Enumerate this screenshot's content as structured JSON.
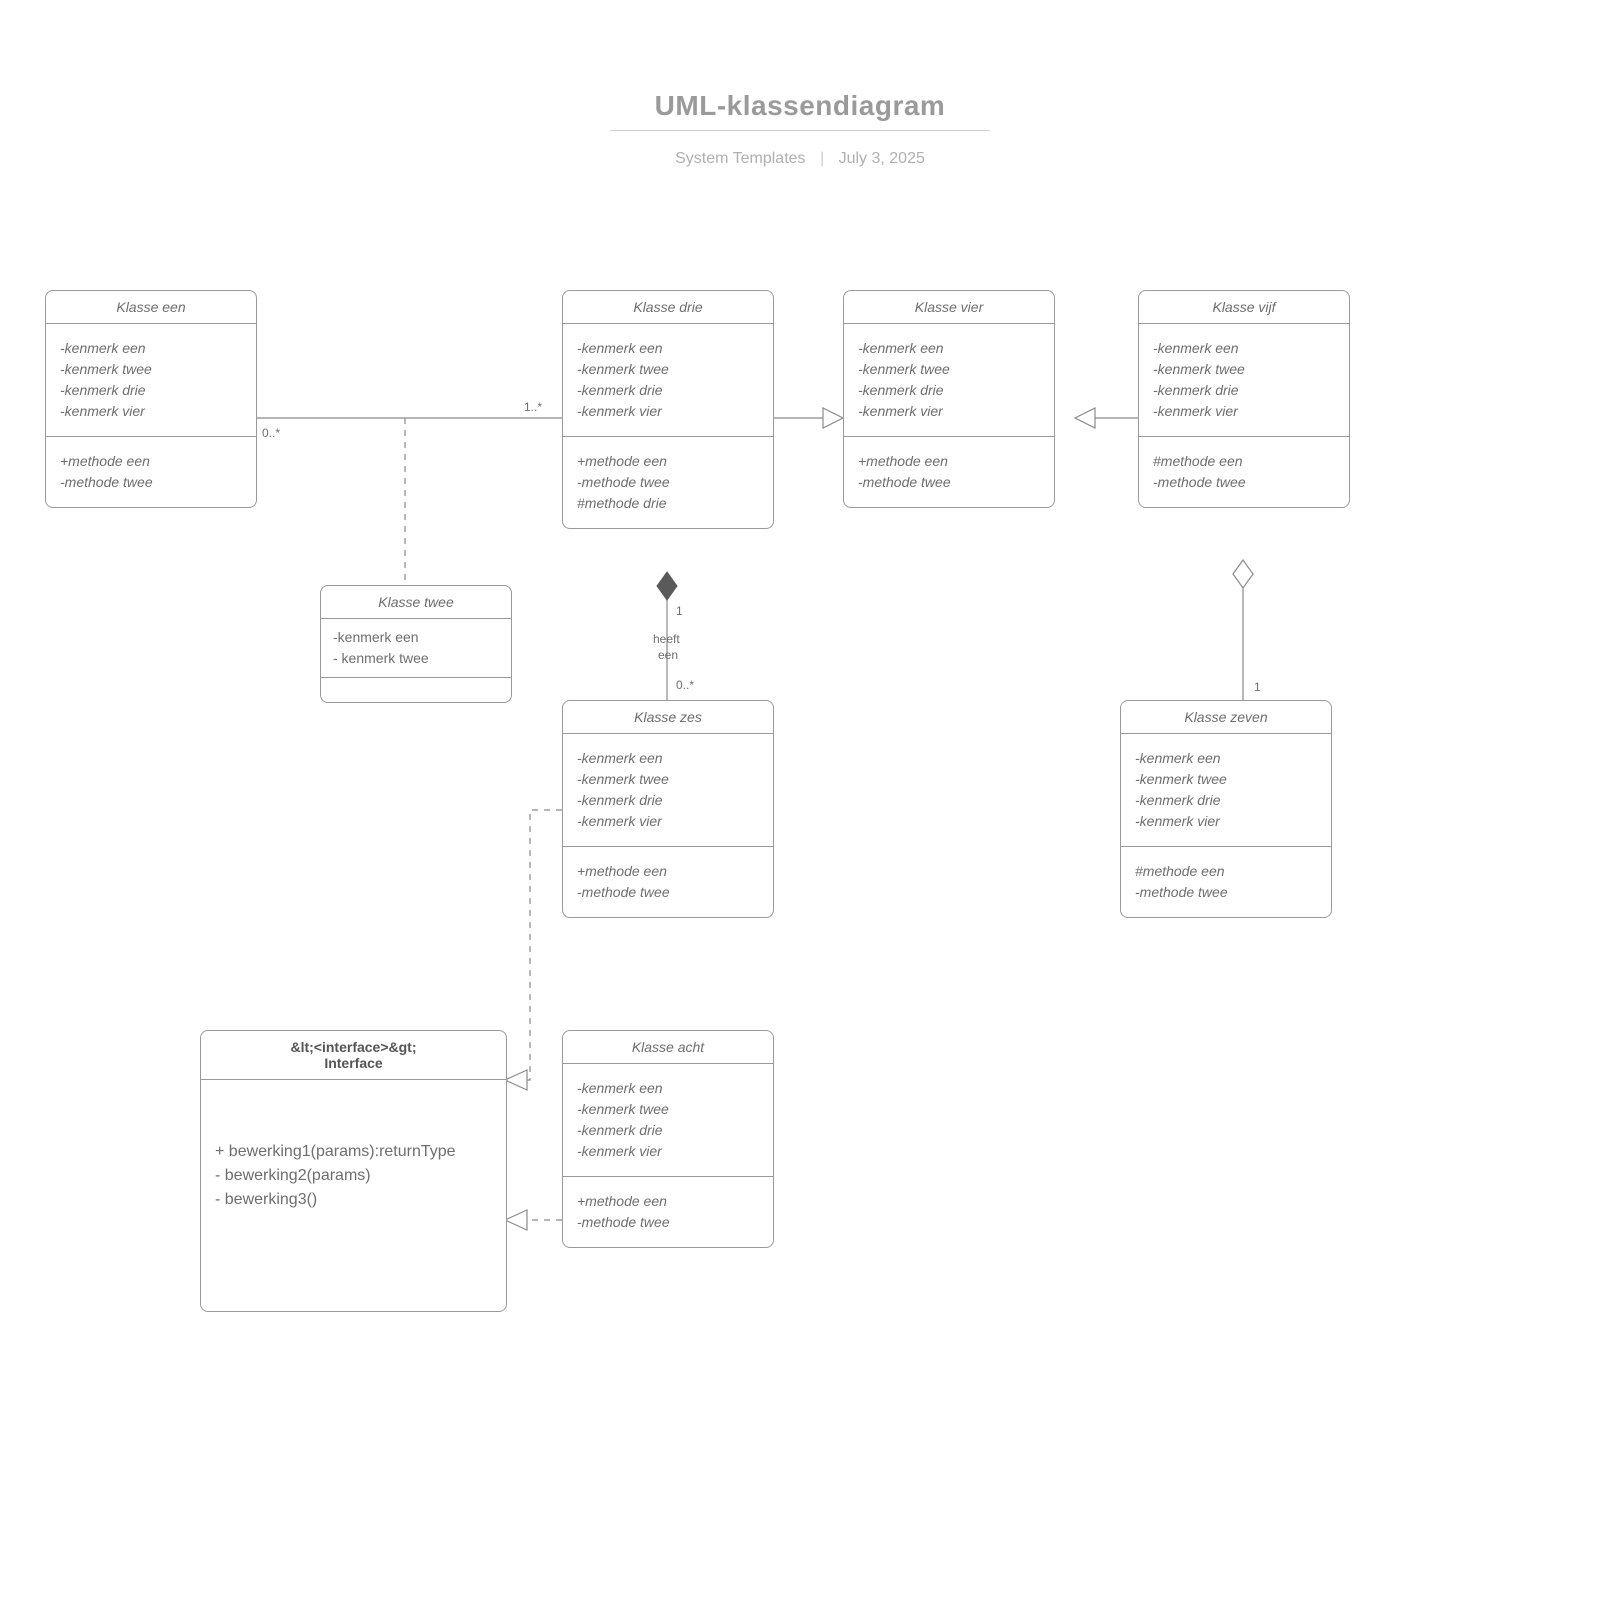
{
  "header": {
    "title": "UML-klassendiagram",
    "author": "System Templates",
    "date": "July 3, 2025"
  },
  "classes": {
    "k1": {
      "name": "Klasse een",
      "attrs": [
        "-kenmerk een",
        "-kenmerk twee",
        "-kenmerk drie",
        "-kenmerk vier"
      ],
      "ops": [
        "+methode een",
        "-methode twee"
      ]
    },
    "k2": {
      "name": "Klasse twee",
      "attrs": [
        "-kenmerk een",
        "- kenmerk twee"
      ],
      "ops": []
    },
    "k3": {
      "name": "Klasse drie",
      "attrs": [
        "-kenmerk een",
        "-kenmerk twee",
        "-kenmerk drie",
        "-kenmerk vier"
      ],
      "ops": [
        "+methode een",
        "-methode twee",
        "#methode drie"
      ]
    },
    "k4": {
      "name": "Klasse vier",
      "attrs": [
        "-kenmerk een",
        "-kenmerk twee",
        "-kenmerk drie",
        "-kenmerk vier"
      ],
      "ops": [
        "+methode een",
        "-methode twee"
      ]
    },
    "k5": {
      "name": "Klasse vijf",
      "attrs": [
        "-kenmerk een",
        "-kenmerk twee",
        "-kenmerk drie",
        "-kenmerk vier"
      ],
      "ops": [
        "#methode een",
        "-methode twee"
      ]
    },
    "k6": {
      "name": "Klasse zes",
      "attrs": [
        "-kenmerk een",
        "-kenmerk twee",
        "-kenmerk drie",
        "-kenmerk vier"
      ],
      "ops": [
        "+methode een",
        "-methode twee"
      ]
    },
    "k7": {
      "name": "Klasse zeven",
      "attrs": [
        "-kenmerk een",
        "-kenmerk twee",
        "-kenmerk drie",
        "-kenmerk vier"
      ],
      "ops": [
        "#methode een",
        "-methode twee"
      ]
    },
    "k8": {
      "name": "Klasse acht",
      "attrs": [
        "-kenmerk een",
        "-kenmerk twee",
        "-kenmerk drie",
        "-kenmerk vier"
      ],
      "ops": [
        "+methode een",
        "-methode twee"
      ]
    },
    "iface": {
      "stereo": "&lt;<interface>&gt;",
      "name": "Interface",
      "ops": [
        "+ bewerking1(params):returnType",
        "- bewerking2(params)",
        "- bewerking3()"
      ]
    }
  },
  "edges": {
    "k1_k3": {
      "left_mult": "0..*",
      "right_mult": "1..*"
    },
    "k3_k6": {
      "top_mult": "1",
      "label_line1": "heeft",
      "label_line2": "een",
      "bottom_mult": "0..*"
    },
    "k5_k7": {
      "bottom_mult": "1"
    }
  }
}
